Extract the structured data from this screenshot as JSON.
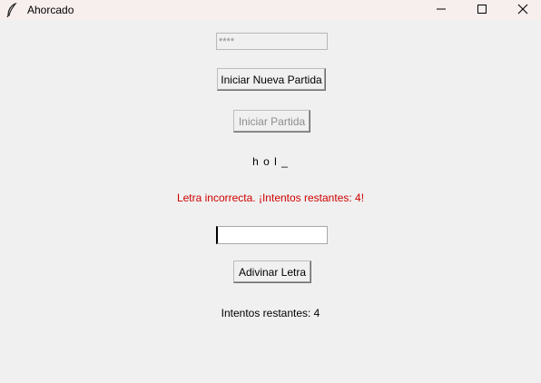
{
  "window": {
    "title": "Ahorcado",
    "icon": "feather-icon",
    "controls": [
      "minimize-icon",
      "maximize-icon",
      "close-icon"
    ]
  },
  "secret_entry": {
    "value": "****"
  },
  "buttons": {
    "new_game": "Iniciar Nueva Partida",
    "start_game": "Iniciar Partida",
    "guess_letter": "Adivinar Letra"
  },
  "word_display": "h o l _",
  "message": {
    "text": "Letra incorrecta. ¡Intentos restantes: 4!",
    "color": "#d00000"
  },
  "guess_entry": {
    "value": ""
  },
  "attempts_label": "Intentos restantes: 4"
}
